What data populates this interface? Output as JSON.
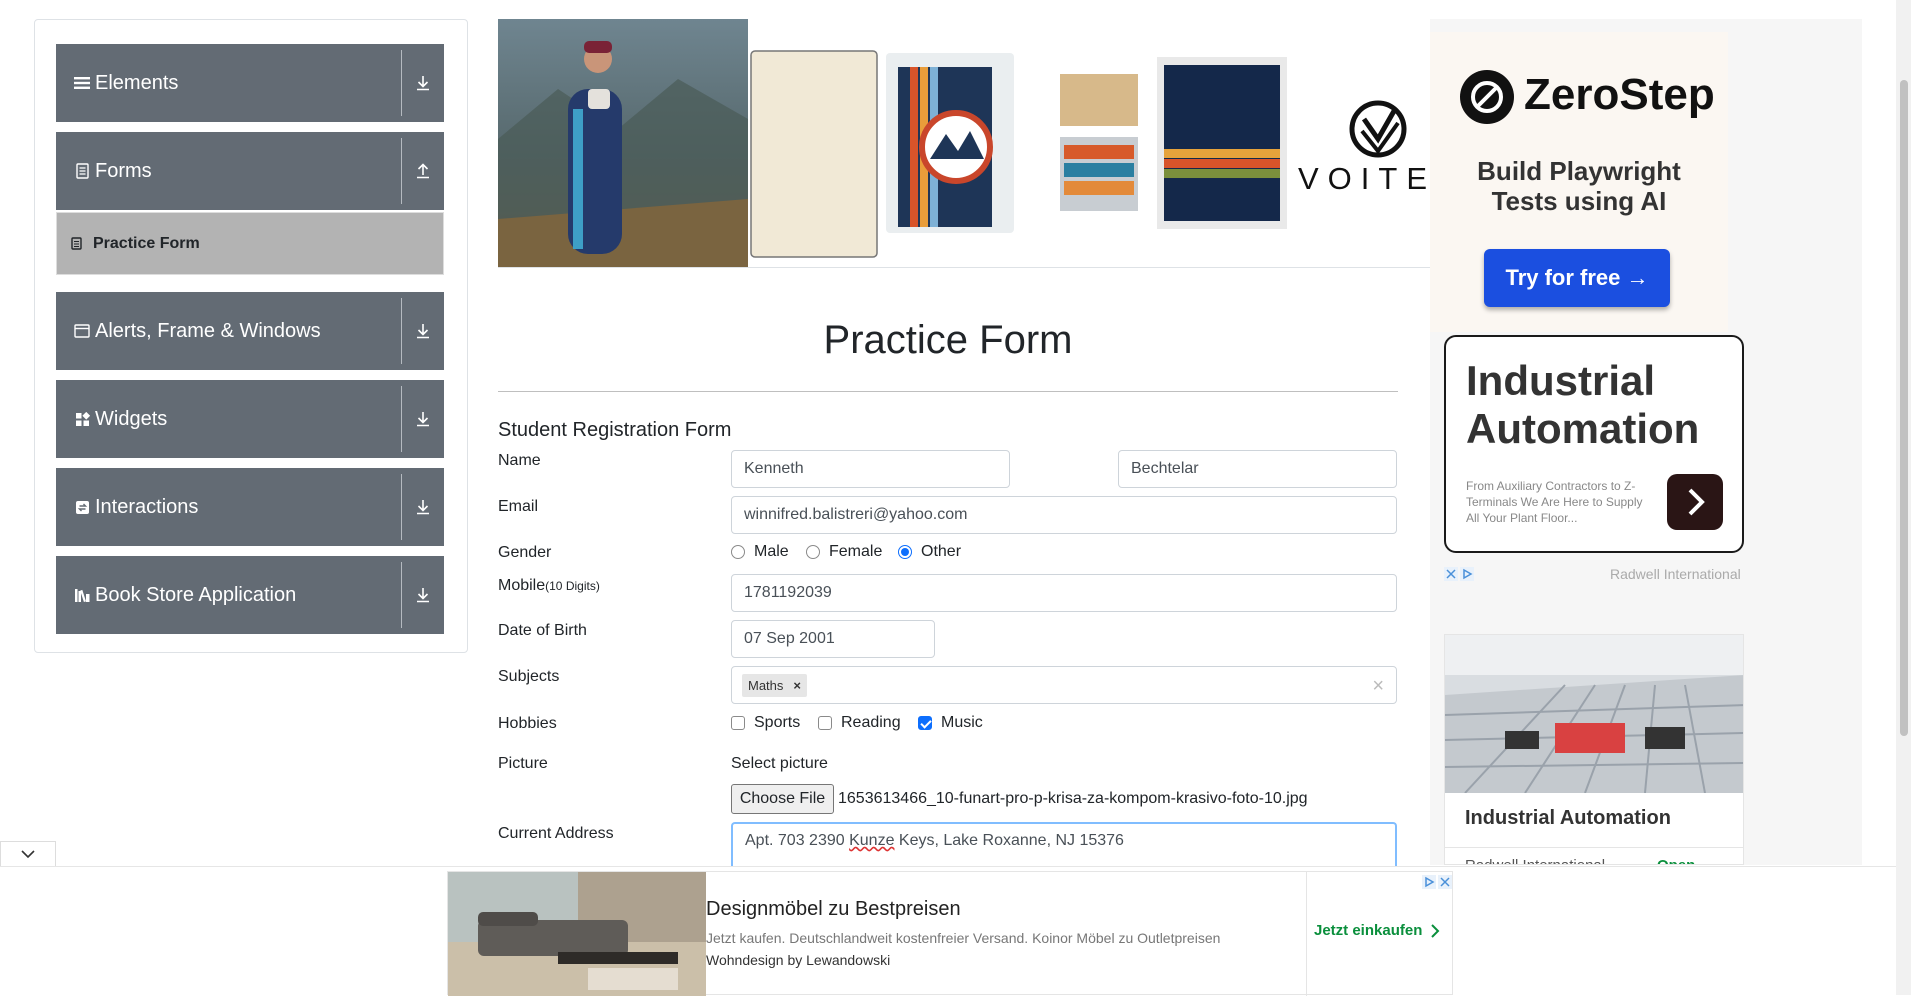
{
  "sidebar": {
    "groups": [
      {
        "label": "Elements",
        "icon": "hamburger-icon",
        "arrow": "download-arrow-icon"
      },
      {
        "label": "Forms",
        "icon": "document-icon",
        "arrow": "upload-arrow-icon"
      },
      {
        "label": "Alerts, Frame & Windows",
        "icon": "window-icon",
        "arrow": "download-arrow-icon"
      },
      {
        "label": "Widgets",
        "icon": "widgets-icon",
        "arrow": "download-arrow-icon"
      },
      {
        "label": "Interactions",
        "icon": "interactions-icon",
        "arrow": "download-arrow-icon"
      },
      {
        "label": "Book Store Application",
        "icon": "books-icon",
        "arrow": "download-arrow-icon"
      }
    ],
    "active_item": {
      "label": "Practice Form",
      "icon": "form-icon"
    }
  },
  "banner": {
    "brand": "VOITE"
  },
  "page": {
    "title": "Practice Form"
  },
  "form": {
    "heading": "Student Registration Form",
    "labels": {
      "name": "Name",
      "email": "Email",
      "gender": "Gender",
      "mobile": "Mobile",
      "mobile_hint": "(10 Digits)",
      "dob": "Date of Birth",
      "subjects": "Subjects",
      "hobbies": "Hobbies",
      "picture": "Picture",
      "address": "Current Address"
    },
    "first_name": "Kenneth",
    "last_name": "Bechtelar",
    "email": "winnifred.balistreri@yahoo.com",
    "gender_options": [
      "Male",
      "Female",
      "Other"
    ],
    "gender_selected": "Other",
    "mobile": "1781192039",
    "dob": "07 Sep 2001",
    "subjects": [
      "Maths"
    ],
    "subject_remove": "×",
    "subjects_clear": "×",
    "hobbies": [
      {
        "label": "Sports",
        "checked": false
      },
      {
        "label": "Reading",
        "checked": false
      },
      {
        "label": "Music",
        "checked": true
      }
    ],
    "picture_label": "Select picture",
    "choose_file": "Choose File",
    "file_name": "1653613466_10-funart-pro-p-krisa-za-kompom-krasivo-foto-10.jpg",
    "address_pre": "Apt. 703 2390 ",
    "address_underlined": "Kunze",
    "address_post": " Keys, Lake Roxanne, NJ 15376"
  },
  "ads": {
    "zerostep": {
      "brand": "ZeroStep",
      "line1": "Build Playwright",
      "line2": "Tests using AI",
      "cta": "Try for free →"
    },
    "industrial": {
      "title_line1": "Industrial",
      "title_line2": "Automation",
      "text": "From Auxiliary Contractors to Z-Terminals We Are Here to Supply All Your Plant Floor...",
      "advertiser": "Radwell International"
    },
    "industrial2": {
      "title": "Industrial Automation",
      "advertiser": "Radwell International",
      "cta": "Open"
    },
    "bottom": {
      "title": "Designmöbel zu Bestpreisen",
      "text": "Jetzt kaufen. Deutschlandweit kostenfreier Versand. Koinor Möbel zu Outletpreisen",
      "advertiser": "Wohndesign by Lewandowski",
      "cta": "Jetzt einkaufen"
    }
  },
  "colors": {
    "sidebar_group": "#636b74",
    "active_item": "#b3b3b3",
    "accent": "#0d6efd",
    "cta_blue": "#1b4fe0"
  }
}
